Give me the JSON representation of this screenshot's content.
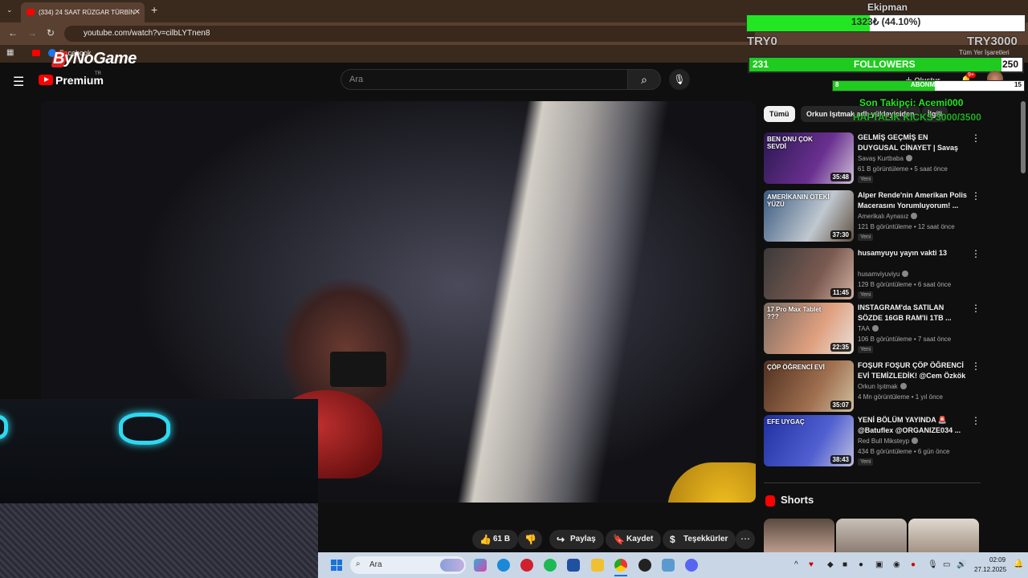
{
  "browser": {
    "tab_title": "(334) 24 SAAT RÜZGAR TÜRBİN",
    "tab_close": "✕",
    "new_tab": "+",
    "url": "youtube.com/watch?v=cilbLYTnen8",
    "bookmarks": {
      "facebook": "Facebook",
      "all_bookmarks": "Tüm Yer İşaretleri"
    },
    "nav": {
      "back": "←",
      "forward": "→",
      "reload": "↻"
    }
  },
  "overlay": {
    "brand": "ByNoGame",
    "ekipman_label": "Ekipman",
    "ekipman_text": "1323₺ (44.10%)",
    "ekipman_progress": 0.441,
    "try_min": "TRY0",
    "try_max": "TRY3000",
    "followers_current": "231",
    "followers_label": "FOLLOWERS",
    "followers_target": "250",
    "followers_progress": 0.924,
    "sub_current": "8",
    "sub_label": "ABONMAN",
    "sub_target": "15",
    "sub_progress": 0.533,
    "last_follower": "Son Takipçi: Acemi000",
    "kicks": "HAFTALIK KICKS 3000/3500"
  },
  "youtube": {
    "premium_label": "Premium",
    "premium_region": "TR",
    "search_placeholder": "Ara",
    "create_label": "Oluştur",
    "notif_count": "9+",
    "actions": {
      "like": "61 B",
      "share": "Paylaş",
      "save": "Kaydet",
      "thanks": "Teşekkürler",
      "more": "⋯"
    },
    "chips": [
      "Tümü",
      "Orkun Işıtmak adlı yükleyiciden",
      "İlgili"
    ],
    "recommendations": [
      {
        "title": "GELMİŞ GEÇMİŞ EN DUYGUSAL CİNAYET | Savaş Kurtbaba ile ...",
        "channel": "Savaş Kurtbaba",
        "meta": "61 B görüntüleme • 5 saat önce",
        "badge": "Yeni",
        "duration": "35:48",
        "thumb_text": "BEN ONU ÇOK SEVDİ"
      },
      {
        "title": "Alper Rende'nin Amerikan Polis Macerasını Yorumluyorum! ...",
        "channel": "Amerikalı Aynasız",
        "meta": "121 B görüntüleme • 12 saat önce",
        "badge": "Yeni",
        "duration": "37:30",
        "thumb_text": "AMERİKANIN ÖTEKİ YÜZÜ"
      },
      {
        "title": "husamyuyu yayın vakti 13",
        "channel": "husamviyuviyu",
        "meta": "129 B görüntüleme • 6 saat önce",
        "badge": "Yeni",
        "duration": "11:45",
        "thumb_text": ""
      },
      {
        "title": "INSTAGRAM'da SATILAN SÖZDE 16GB RAM'li 1TB ...",
        "channel": "TAA",
        "meta": "106 B görüntüleme • 7 saat önce",
        "badge": "Yeni",
        "duration": "22:35",
        "thumb_text": "17 Pro Max Tablet ???"
      },
      {
        "title": "FOŞUR FOŞUR ÇÖP ÖĞRENCİ EVİ TEMİZLEDİK! @Cem Özkök",
        "channel": "Orkun Işıtmak",
        "meta": "4 Mn görüntüleme • 1 yıl önce",
        "badge": "",
        "duration": "35:07",
        "thumb_text": "ÇÖP ÖĞRENCİ EVİ"
      },
      {
        "title": "YENİ BÖLÜM YAYINDA 🚨 @Batuflex @ORGANIZE034 ...",
        "channel": "Red Bull Miksteyp",
        "meta": "434 B görüntüleme • 6 gün önce",
        "badge": "Yeni",
        "duration": "38:43",
        "thumb_text": "EFE UYGAÇ"
      }
    ],
    "shorts_title": "Shorts"
  },
  "taskbar": {
    "search_placeholder": "Ara",
    "time": "02:09",
    "date": "27.12.2025"
  },
  "colors": {
    "progress_green": "#22e622",
    "taskbar_bg": "#c9d6e6",
    "yt_red": "#ff0000"
  }
}
